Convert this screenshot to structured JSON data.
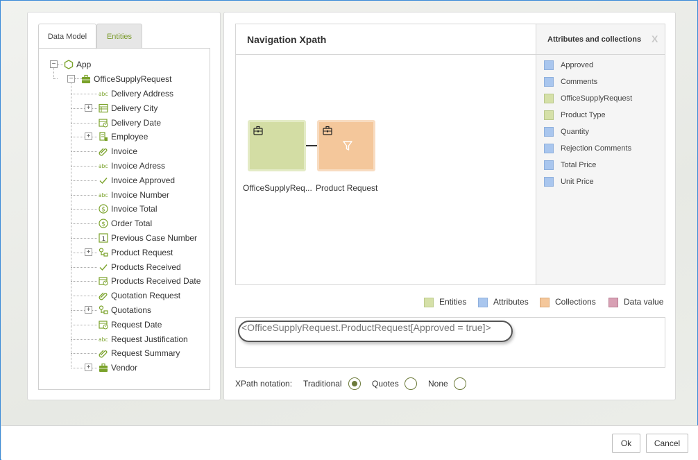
{
  "tabs": {
    "data_model": "Data Model",
    "entities": "Entities"
  },
  "tree": {
    "root": "App",
    "entity": "OfficeSupplyRequest",
    "items": [
      {
        "label": "Delivery Address",
        "icon": "text-icon",
        "expandable": false
      },
      {
        "label": "Delivery City",
        "icon": "list-icon",
        "expandable": true
      },
      {
        "label": "Delivery Date",
        "icon": "date-icon",
        "expandable": false
      },
      {
        "label": "Employee",
        "icon": "document-list-icon",
        "expandable": true
      },
      {
        "label": "Invoice",
        "icon": "attachment-icon",
        "expandable": false
      },
      {
        "label": "Invoice Adress",
        "icon": "text-icon",
        "expandable": false
      },
      {
        "label": "Invoice Approved",
        "icon": "check-icon",
        "expandable": false
      },
      {
        "label": "Invoice Number",
        "icon": "text-icon",
        "expandable": false
      },
      {
        "label": "Invoice Total",
        "icon": "currency-icon",
        "expandable": false
      },
      {
        "label": "Order Total",
        "icon": "currency-icon",
        "expandable": false
      },
      {
        "label": "Previous Case Number",
        "icon": "number-icon",
        "expandable": false
      },
      {
        "label": "Product Request",
        "icon": "collection-icon",
        "expandable": true
      },
      {
        "label": "Products Received",
        "icon": "check-icon",
        "expandable": false
      },
      {
        "label": "Products Received Date",
        "icon": "date-icon",
        "expandable": false
      },
      {
        "label": "Quotation Request",
        "icon": "attachment-icon",
        "expandable": false
      },
      {
        "label": "Quotations",
        "icon": "collection-icon",
        "expandable": true
      },
      {
        "label": "Request Date",
        "icon": "date-icon",
        "expandable": false
      },
      {
        "label": "Request Justification",
        "icon": "text-icon",
        "expandable": false
      },
      {
        "label": "Request Summary",
        "icon": "attachment-icon",
        "expandable": false
      },
      {
        "label": "Vendor",
        "icon": "entity-icon",
        "expandable": true
      }
    ],
    "text_icon_glyph": "abc",
    "number_icon_glyph": "1"
  },
  "navigation": {
    "title": "Navigation Xpath",
    "nodes": [
      {
        "label": "OfficeSupplyReq...",
        "kind": "entity"
      },
      {
        "label": "Product Request",
        "kind": "collection"
      }
    ]
  },
  "attributes": {
    "title": "Attributes and collections",
    "close": "X",
    "items": [
      {
        "label": "Approved",
        "kind": "attribute"
      },
      {
        "label": "Comments",
        "kind": "attribute"
      },
      {
        "label": "OfficeSupplyRequest",
        "kind": "entity"
      },
      {
        "label": "Product Type",
        "kind": "entity"
      },
      {
        "label": "Quantity",
        "kind": "attribute"
      },
      {
        "label": "Rejection Comments",
        "kind": "attribute"
      },
      {
        "label": "Total Price",
        "kind": "attribute"
      },
      {
        "label": "Unit Price",
        "kind": "attribute"
      }
    ]
  },
  "legend": [
    {
      "label": "Entities",
      "color": "#d5e0a8"
    },
    {
      "label": "Attributes",
      "color": "#a9c6ee"
    },
    {
      "label": "Collections",
      "color": "#f4c79b"
    },
    {
      "label": "Data value",
      "color": "#d8a0b4"
    }
  ],
  "xpath": {
    "expression": "<OfficeSupplyRequest.ProductRequest[Approved = true]>"
  },
  "notation": {
    "label": "XPath notation:",
    "options": [
      {
        "label": "Traditional",
        "selected": true
      },
      {
        "label": "Quotes",
        "selected": false
      },
      {
        "label": "None",
        "selected": false
      }
    ]
  },
  "footer": {
    "ok": "Ok",
    "cancel": "Cancel"
  },
  "colors": {
    "accent_green": "#6c7a3a",
    "entity": "#d5e0a8",
    "attribute": "#a9c6ee",
    "collection": "#f4c79b",
    "data_value": "#d8a0b4"
  }
}
